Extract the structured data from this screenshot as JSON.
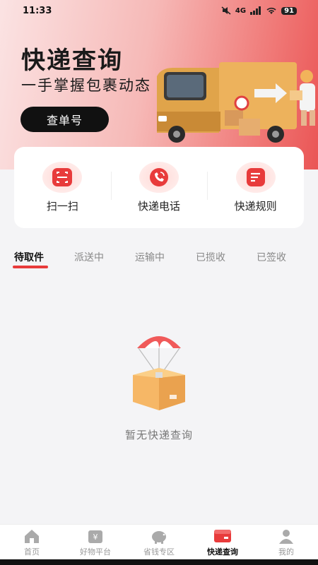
{
  "status": {
    "time": "11:33",
    "network": "4G",
    "battery": "91"
  },
  "hero": {
    "title": "快递查询",
    "subtitle": "一手掌握包裹动态",
    "button_label": "查单号"
  },
  "actions": [
    {
      "label": "扫一扫",
      "icon": "scan-icon"
    },
    {
      "label": "快递电话",
      "icon": "phone-icon"
    },
    {
      "label": "快递规则",
      "icon": "rules-icon"
    }
  ],
  "tabs": [
    "待取件",
    "派送中",
    "运输中",
    "已揽收",
    "已签收"
  ],
  "active_tab": 0,
  "empty": {
    "text": "暂无快递查询"
  },
  "nav": [
    {
      "label": "首页",
      "icon": "home-icon"
    },
    {
      "label": "好物平台",
      "icon": "shop-icon"
    },
    {
      "label": "省钱专区",
      "icon": "piggy-bank-icon"
    },
    {
      "label": "快递查询",
      "icon": "parcel-icon"
    },
    {
      "label": "我的",
      "icon": "user-icon"
    }
  ],
  "active_nav": 3,
  "colors": {
    "accent": "#e83b3b",
    "hero_start": "#fbe3e3",
    "hero_end": "#ea5555"
  }
}
